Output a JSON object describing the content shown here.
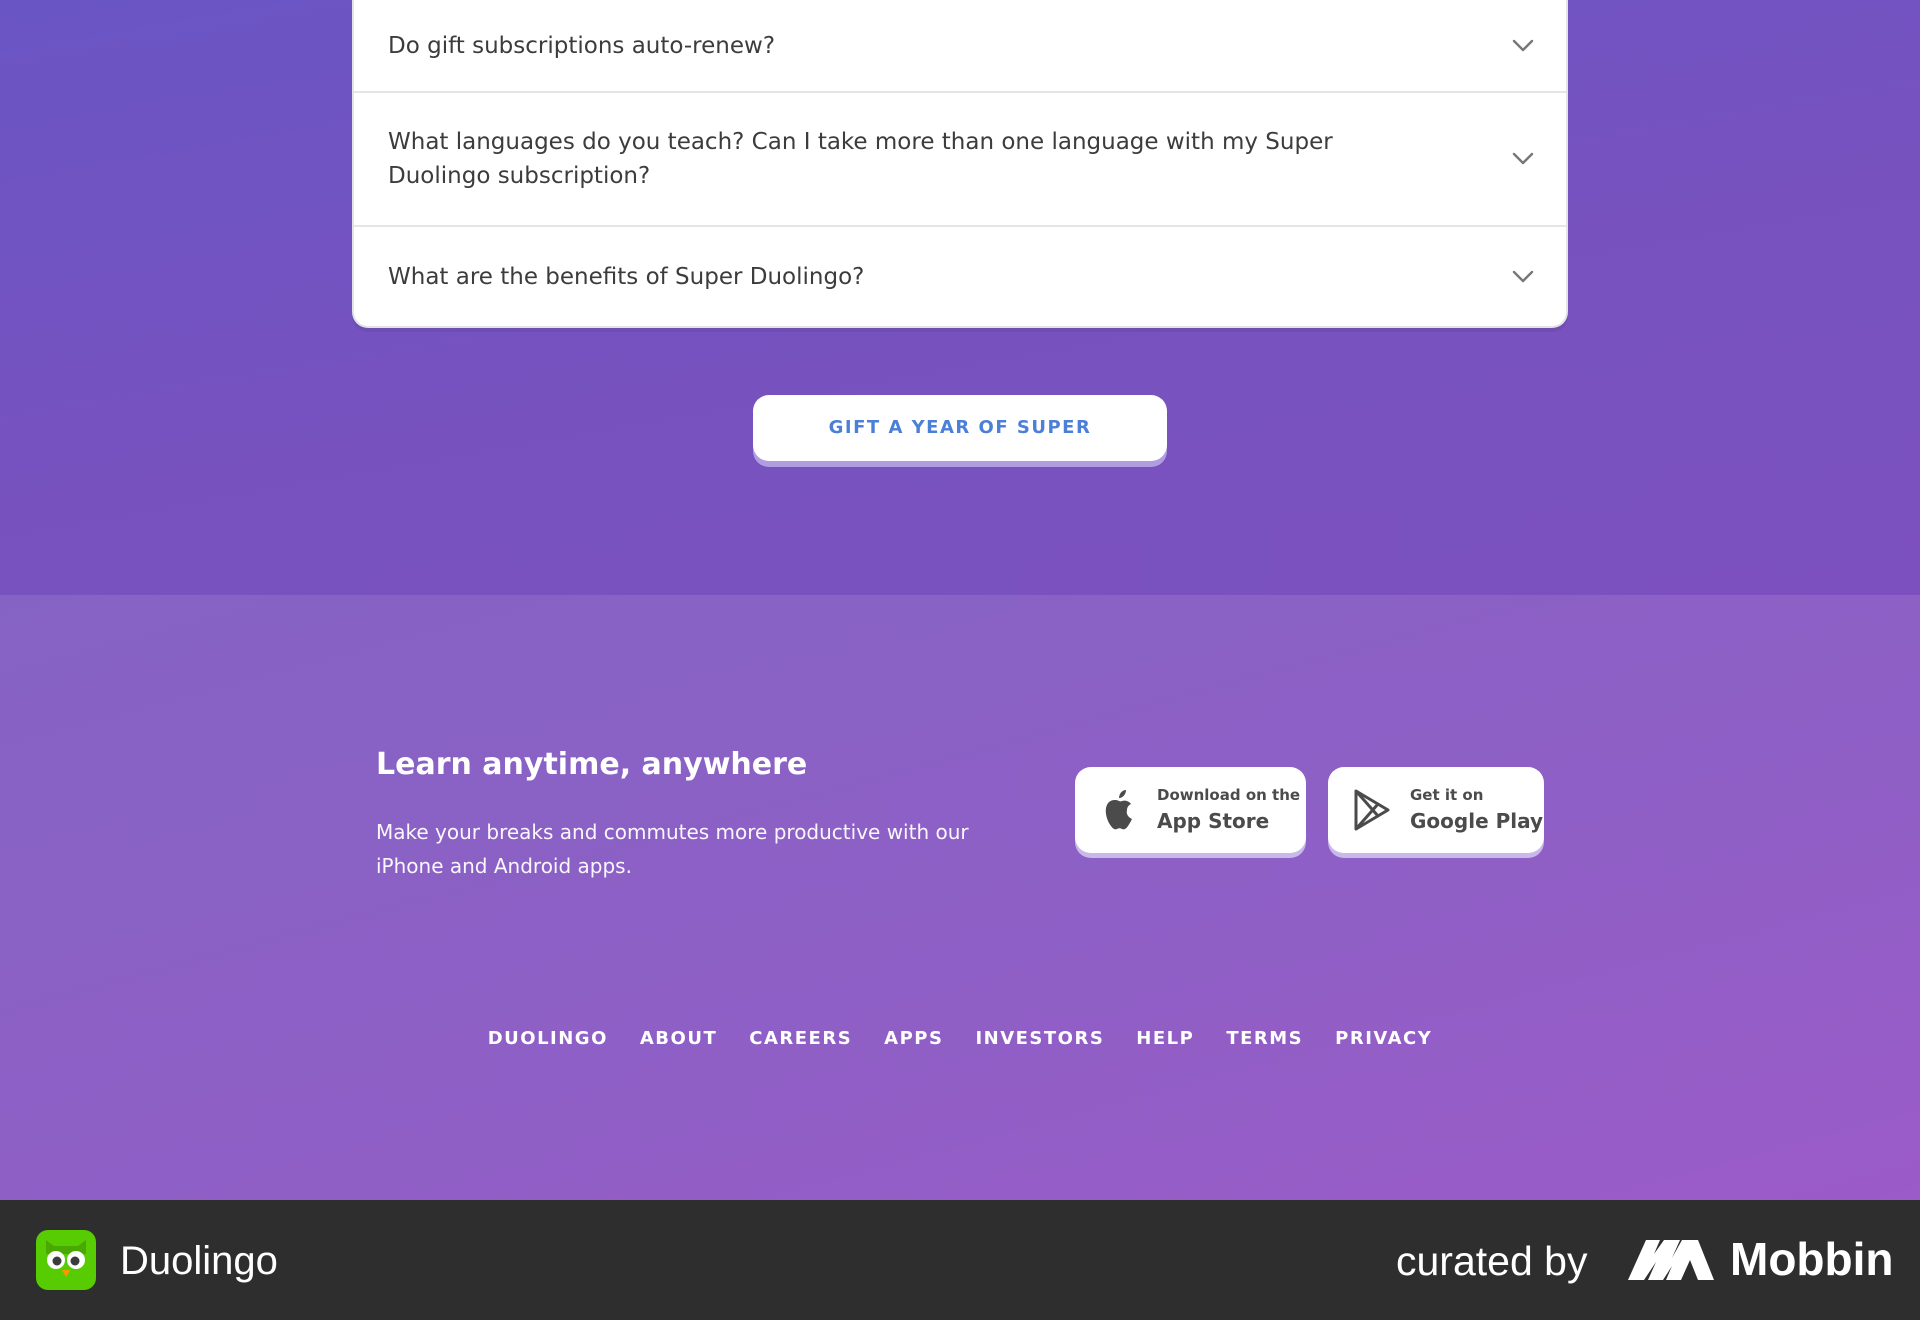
{
  "faq": {
    "items": [
      {
        "question": "Do gift subscriptions auto-renew?",
        "icon": "chevron-down-icon"
      },
      {
        "question": "What languages do you teach? Can I take more than one language with my Super Duolingo subscription?",
        "icon": "chevron-down-icon"
      },
      {
        "question": "What are the benefits of Super Duolingo?",
        "icon": "chevron-down-icon"
      }
    ]
  },
  "gift_button": {
    "label": "GIFT A YEAR OF SUPER"
  },
  "apps": {
    "title": "Learn anytime, anywhere",
    "text": "Make your breaks and commutes more productive with our iPhone and Android apps.",
    "app_store": {
      "small": "Download on the",
      "big": "App Store",
      "icon": "apple-icon"
    },
    "google_play": {
      "small": "Get it on",
      "big": "Google Play",
      "icon": "google-play-icon"
    }
  },
  "footer_links": [
    "DUOLINGO",
    "ABOUT",
    "CAREERS",
    "APPS",
    "INVESTORS",
    "HELP",
    "TERMS",
    "PRIVACY"
  ],
  "attribution": {
    "app_name": "Duolingo",
    "curated_by": "curated by",
    "curator": "Mobbin"
  },
  "colors": {
    "hero_purple": "#7053c2",
    "footer_purple": "#8f5fc6",
    "gift_text_blue": "#4b7fd8",
    "duolingo_green": "#58cc02",
    "bottom_bar": "#2e2e2e"
  }
}
